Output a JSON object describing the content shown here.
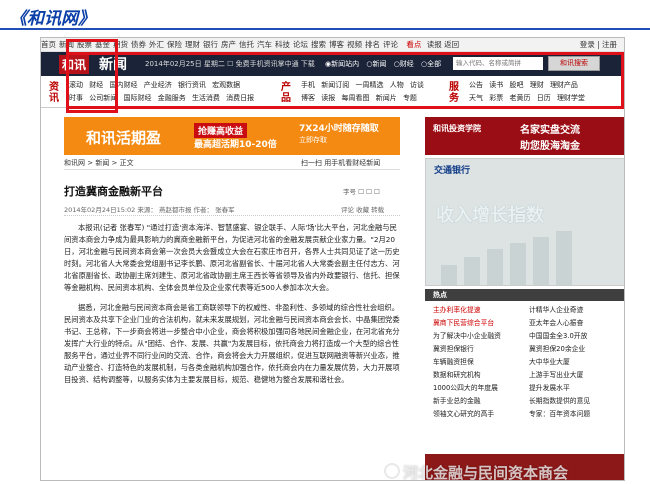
{
  "slide": {
    "title": "《和讯网》"
  },
  "topnav": {
    "items": [
      "首页",
      "新闻",
      "股票",
      "基金",
      "期货",
      "债券",
      "外汇",
      "保险",
      "理财",
      "银行",
      "房产",
      "信托",
      "汽车",
      "科技",
      "论坛",
      "搜索",
      "博客",
      "视频",
      "排名",
      "评论"
    ],
    "hot": "看点",
    "extra": "读报 返回",
    "login": "登录 | 注册"
  },
  "brand": {
    "logo": "和讯",
    "name": "新闻",
    "date": "2014年02月25日 星期二 ☐ 免费手机资讯掌中通 下载",
    "radios": [
      "◉新闻站内",
      "○新闻",
      "○财经",
      "○全部"
    ],
    "search_placeholder": "输入代码、名称或简拼",
    "search_button": "和讯搜索"
  },
  "channels": {
    "left_title": "资讯",
    "left_rows": [
      [
        "滚动",
        "财经",
        "国内财经",
        "产业经济",
        "银行资讯",
        "宏观数据"
      ],
      [
        "时事",
        "公司新闻",
        "国际财经",
        "金融服务",
        "生活消费",
        "消费日报"
      ]
    ],
    "mid_title": "产品",
    "mid_rows": [
      [
        "手机",
        "新闻订阅",
        "一周精选",
        "人物",
        "访谈"
      ],
      [
        "博客",
        "读报",
        "每周看图",
        "新闻片",
        "专题"
      ]
    ],
    "right_title": "服务",
    "right_rows": [
      [
        "公告",
        "读书",
        "股吧",
        "理财",
        "理财产品"
      ],
      [
        "天气",
        "彩票",
        "老黄历",
        "日历",
        "理财学堂"
      ]
    ]
  },
  "banners": {
    "left_main": "和讯活期盈",
    "left_badge": "抢赚高收益",
    "left_rate": "最高超活期10-20倍",
    "left_side": "7X24小时随存随取",
    "left_sub": "立即存取",
    "right_label": "和讯投资学院",
    "right_line1": "名家实盘交流",
    "right_line2": "助您股海淘金"
  },
  "breadcrumb": {
    "path": "和讯网 > 新闻 > 正文",
    "ad": "扫一扫 用手机看财经新闻"
  },
  "article": {
    "title": "打造冀商金融新平台",
    "tools": "字号 ☐  ☐  ☐",
    "meta": "2014年02月24日15:02   来源：  燕赵都市报    作者：  张春军",
    "meta_right": "评论 收藏 转载",
    "paragraphs": [
      "本报讯(记者 张春军) \"通过打造'资本海洋、智慧盛宴、银企联手、人际'场'比大平台，河北金融与民间资本商会力争成为最具影响力的冀商金融新平台，为促进河北省的金融发展贡献企业家力量。\"2月20日，河北金融与民间资本商会第一次会员大会暨成立大会在石家庄市召开，各界人士共同见证了这一历史时刻。河北省人大常委会党组副书记李长鹏、原河北省副省长、十届河北省人大常委会副主任付志方、河北省原副省长、政协副主席刘建生、原河北省政协副主席王西长等省领导及省内外政要银行、信托、担保等金融机构、民间资本机构、全体会员单位及企业家代表等近500人参加本次大会。",
      "据悉，河北金融与民间资本商会是省工商联领导下的权威性、非盈利性、多领域的综合性社会组织。民间资本及共享下企业门业的合法机构，就未来发展规划，河北金融与民间资本商会会长、中晶集团党委书记、王总称，下一步商会将进一步整合中小企业，商会将积极加强同各地民间金融企业，在河北省充分发挥广大行业的特点。从\"团结、合作、发展、共赢\"为发展目标，依托商会力将打造成一个大型的综合性服务平台，通过业界不同行业间的交流、合作，商会将会大力开展组织，促进互联网融资等新兴业态，推动产业整合、打造特色的发展机制，与各类金融机构加强合作，依托商会内在力量发展优势，大力开展项目投资、结构调整等，以服务实体为主要发展目标，规范、稳健地为整合发展和谐社会。"
    ]
  },
  "right": {
    "bank": "交通银行",
    "big": "收入增长指数",
    "hot_title": "热点",
    "hot": [
      [
        "主办利率化提速",
        "计精华人企业奇迹"
      ],
      [
        "冀商下民营综合平台",
        "亚太年会人心振奋"
      ],
      [
        "为了解决中小企业融资",
        "中国国金全3.0开放"
      ],
      [
        "冀资担保银行",
        "冀资担保20余企业"
      ],
      [
        "车辆融资担保",
        "大中华业大厦"
      ],
      [
        "数据和研究机构",
        "上游手写出业大厦"
      ],
      [
        "1000公四大的年度展",
        "提升发展水平"
      ],
      [
        "新手业总的金融",
        "长期指数提供的意见"
      ],
      [
        "领袖文心研究的高手",
        "专家：百年资本问题"
      ]
    ]
  },
  "watermark": "河北金融与民间资本商会",
  "colors": {
    "accent": "#e0101a",
    "nav_dark": "#1b2338",
    "title_blue": "#0b3fa8"
  }
}
